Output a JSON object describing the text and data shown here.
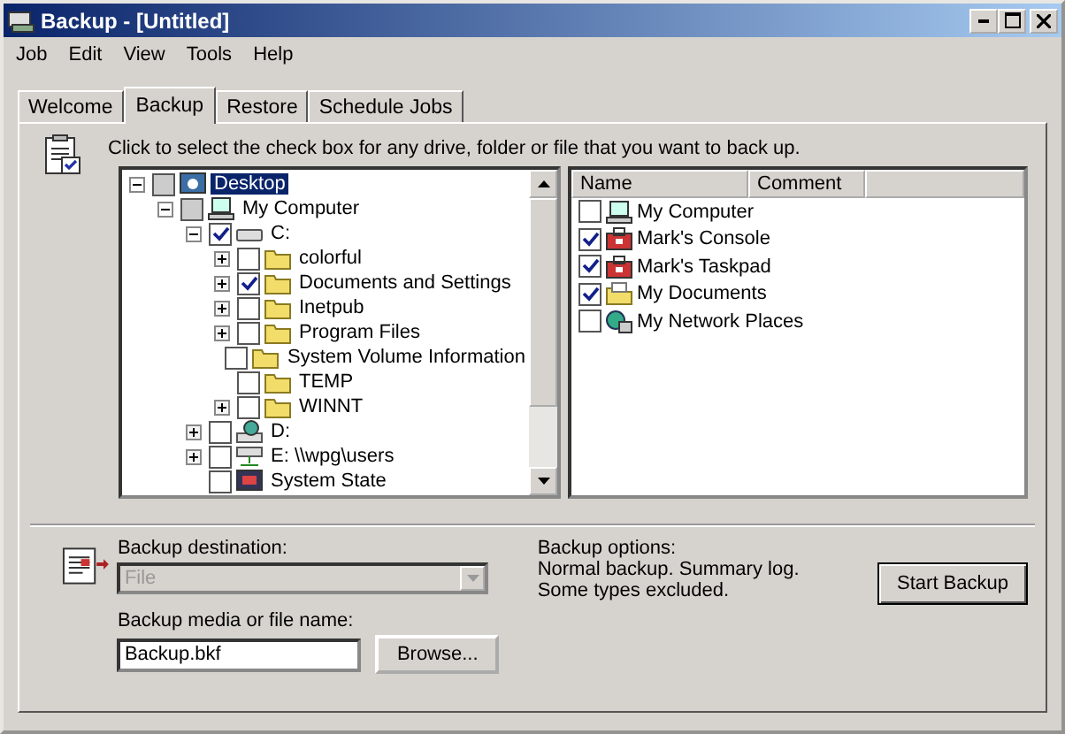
{
  "window": {
    "title": "Backup - [Untitled]"
  },
  "menu": [
    "Job",
    "Edit",
    "View",
    "Tools",
    "Help"
  ],
  "tabs": [
    {
      "label": "Welcome",
      "selected": false
    },
    {
      "label": "Backup",
      "selected": true
    },
    {
      "label": "Restore",
      "selected": false
    },
    {
      "label": "Schedule Jobs",
      "selected": false
    }
  ],
  "instruction": "Click to select the check box for any drive, folder or file that you want to back up.",
  "tree": [
    {
      "label": "Desktop",
      "kind": "desktop",
      "checked": false,
      "partial": true,
      "expanded": true,
      "selected": true,
      "children": [
        {
          "label": "My Computer",
          "kind": "computer",
          "checked": false,
          "partial": true,
          "expanded": true,
          "selected": false,
          "children": [
            {
              "label": "C:",
              "kind": "drive",
              "checked": true,
              "partial": false,
              "expanded": true,
              "selected": false,
              "children": [
                {
                  "label": "colorful",
                  "kind": "folder",
                  "checked": false,
                  "partial": false,
                  "expanded": false,
                  "selected": false
                },
                {
                  "label": "Documents and Settings",
                  "kind": "folder",
                  "checked": true,
                  "partial": false,
                  "expanded": false,
                  "selected": false
                },
                {
                  "label": "Inetpub",
                  "kind": "folder",
                  "checked": false,
                  "partial": false,
                  "expanded": false,
                  "selected": false
                },
                {
                  "label": "Program Files",
                  "kind": "folder",
                  "checked": false,
                  "partial": false,
                  "expanded": false,
                  "selected": false
                },
                {
                  "label": "System Volume Information",
                  "kind": "folder",
                  "checked": false,
                  "partial": false,
                  "selected": false
                },
                {
                  "label": "TEMP",
                  "kind": "folder",
                  "checked": false,
                  "partial": false,
                  "selected": false
                },
                {
                  "label": "WINNT",
                  "kind": "folder",
                  "checked": false,
                  "partial": false,
                  "expanded": false,
                  "selected": false
                }
              ]
            },
            {
              "label": "D:",
              "kind": "cd-drive",
              "checked": false,
              "partial": false,
              "expanded": false,
              "selected": false
            },
            {
              "label": "E: \\\\wpg\\users",
              "kind": "network-drive",
              "checked": false,
              "partial": false,
              "expanded": false,
              "selected": false
            },
            {
              "label": "System State",
              "kind": "system",
              "checked": false,
              "partial": false,
              "selected": false
            }
          ]
        }
      ]
    }
  ],
  "list": {
    "columns": [
      "Name",
      "Comment"
    ],
    "rows": [
      {
        "name": "My Computer",
        "kind": "computer",
        "checked": false
      },
      {
        "name": "Mark's Console",
        "kind": "console",
        "checked": true
      },
      {
        "name": "Mark's Taskpad",
        "kind": "console",
        "checked": true
      },
      {
        "name": "My Documents",
        "kind": "documents",
        "checked": true
      },
      {
        "name": "My Network Places",
        "kind": "network",
        "checked": false
      }
    ]
  },
  "destination": {
    "label": "Backup destination:",
    "value": "File",
    "disabled": true
  },
  "media": {
    "label": "Backup media or file name:",
    "value": "Backup.bkf"
  },
  "browse_button": "Browse...",
  "options": {
    "heading": "Backup options:",
    "lines": [
      "Normal backup.  Summary log.",
      "Some types excluded."
    ]
  },
  "start_button": "Start Backup"
}
